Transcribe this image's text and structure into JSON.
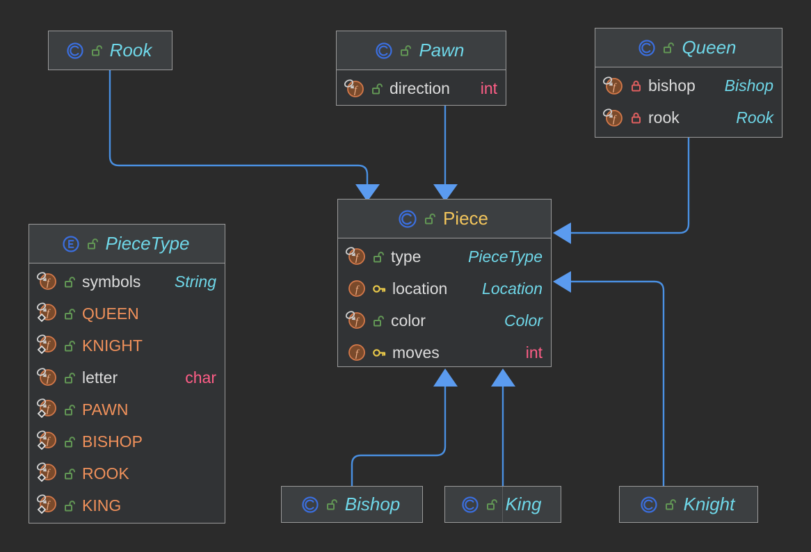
{
  "diagram": {
    "title": "UML class diagram",
    "background_color": "#2b2b2b",
    "edge_color": "#4a90e2",
    "node_border_color": "#9b9b9b",
    "node_header_bg": "#3c3f41",
    "node_body_bg": "#313335"
  },
  "icons": {
    "class": "class-icon",
    "enum": "enum-icon",
    "field": "field-icon",
    "public": "unlocked-padlock-icon",
    "private": "locked-padlock-icon",
    "protected": "key-icon",
    "final": "final-overlay-icon",
    "static": "static-overlay-icon"
  },
  "nodes": [
    {
      "id": "rook",
      "kind": "class",
      "name": "Rook",
      "visibility": "public",
      "members": []
    },
    {
      "id": "pawn",
      "kind": "class",
      "name": "Pawn",
      "visibility": "public",
      "members": [
        {
          "name": "direction",
          "type": "int",
          "type_kind": "primitive",
          "visibility": "public",
          "final": true,
          "static": false
        }
      ]
    },
    {
      "id": "queen",
      "kind": "class",
      "name": "Queen",
      "visibility": "public",
      "members": [
        {
          "name": "bishop",
          "type": "Bishop",
          "type_kind": "reference",
          "visibility": "private",
          "final": true,
          "static": false
        },
        {
          "name": "rook",
          "type": "Rook",
          "type_kind": "reference",
          "visibility": "private",
          "final": true,
          "static": false
        }
      ]
    },
    {
      "id": "piecetype",
      "kind": "enum",
      "name": "PieceType",
      "visibility": "public",
      "members": [
        {
          "name": "symbols",
          "type": "String",
          "type_kind": "reference",
          "visibility": "public",
          "final": true,
          "static": false
        },
        {
          "name": "QUEEN",
          "type": "",
          "type_kind": "none",
          "visibility": "public",
          "final": true,
          "static": true,
          "constant": true
        },
        {
          "name": "KNIGHT",
          "type": "",
          "type_kind": "none",
          "visibility": "public",
          "final": true,
          "static": true,
          "constant": true
        },
        {
          "name": "letter",
          "type": "char",
          "type_kind": "primitive",
          "visibility": "public",
          "final": true,
          "static": false
        },
        {
          "name": "PAWN",
          "type": "",
          "type_kind": "none",
          "visibility": "public",
          "final": true,
          "static": true,
          "constant": true
        },
        {
          "name": "BISHOP",
          "type": "",
          "type_kind": "none",
          "visibility": "public",
          "final": true,
          "static": true,
          "constant": true
        },
        {
          "name": "ROOK",
          "type": "",
          "type_kind": "none",
          "visibility": "public",
          "final": true,
          "static": true,
          "constant": true
        },
        {
          "name": "KING",
          "type": "",
          "type_kind": "none",
          "visibility": "public",
          "final": true,
          "static": true,
          "constant": true
        }
      ]
    },
    {
      "id": "piece",
      "kind": "class",
      "name": "Piece",
      "visibility": "public",
      "members": [
        {
          "name": "type",
          "type": "PieceType",
          "type_kind": "reference",
          "visibility": "public",
          "final": true,
          "static": false
        },
        {
          "name": "location",
          "type": "Location",
          "type_kind": "reference",
          "visibility": "protected",
          "final": false,
          "static": false
        },
        {
          "name": "color",
          "type": "Color",
          "type_kind": "reference",
          "visibility": "public",
          "final": true,
          "static": false
        },
        {
          "name": "moves",
          "type": "int",
          "type_kind": "primitive",
          "visibility": "protected",
          "final": false,
          "static": false
        }
      ]
    },
    {
      "id": "bishop",
      "kind": "class",
      "name": "Bishop",
      "visibility": "public",
      "members": []
    },
    {
      "id": "king",
      "kind": "class",
      "name": "King",
      "visibility": "public",
      "members": []
    },
    {
      "id": "knight",
      "kind": "class",
      "name": "Knight",
      "visibility": "public",
      "members": []
    }
  ],
  "edges": [
    {
      "from": "rook",
      "to": "piece",
      "relation": "inheritance",
      "arrow": "down"
    },
    {
      "from": "pawn",
      "to": "piece",
      "relation": "inheritance",
      "arrow": "down"
    },
    {
      "from": "queen",
      "to": "piece",
      "relation": "inheritance",
      "arrow": "left"
    },
    {
      "from": "knight",
      "to": "piece",
      "relation": "inheritance",
      "arrow": "left"
    },
    {
      "from": "bishop",
      "to": "piece",
      "relation": "inheritance",
      "arrow": "up"
    },
    {
      "from": "king",
      "to": "piece",
      "relation": "inheritance",
      "arrow": "up"
    }
  ]
}
